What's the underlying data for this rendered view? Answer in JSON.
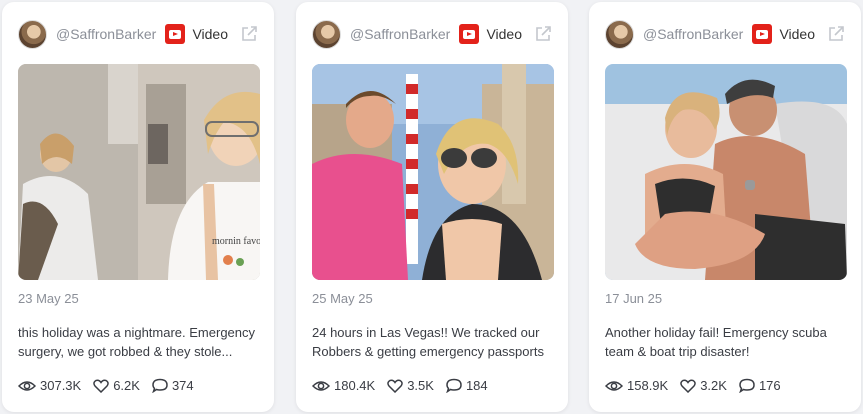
{
  "cards": [
    {
      "handle": "@SaffronBarker",
      "platform": "Video",
      "date": "23 May 25",
      "description": "this holiday was a nightmare. Emergency surgery, we got robbed & they stole...",
      "views": "307.3K",
      "likes": "6.2K",
      "comments": "374",
      "thumbnail_text": "mornin favorite"
    },
    {
      "handle": "@SaffronBarker",
      "platform": "Video",
      "date": "25 May 25",
      "description": "24 hours in Las Vegas!! We tracked our Robbers & getting emergency passports",
      "views": "180.4K",
      "likes": "3.5K",
      "comments": "184"
    },
    {
      "handle": "@SaffronBarker",
      "platform": "Video",
      "date": "17 Jun 25",
      "description": "Another holiday fail! Emergency scuba team & boat trip disaster!",
      "views": "158.9K",
      "likes": "3.2K",
      "comments": "176"
    }
  ],
  "colors": {
    "youtube_red": "#e3221a",
    "muted_text": "#8b8f98",
    "body_text": "#3a3d44",
    "page_bg": "#f1f2f5"
  },
  "icons": [
    "youtube-icon",
    "external-link-icon",
    "eye-icon",
    "heart-icon",
    "comment-icon"
  ]
}
